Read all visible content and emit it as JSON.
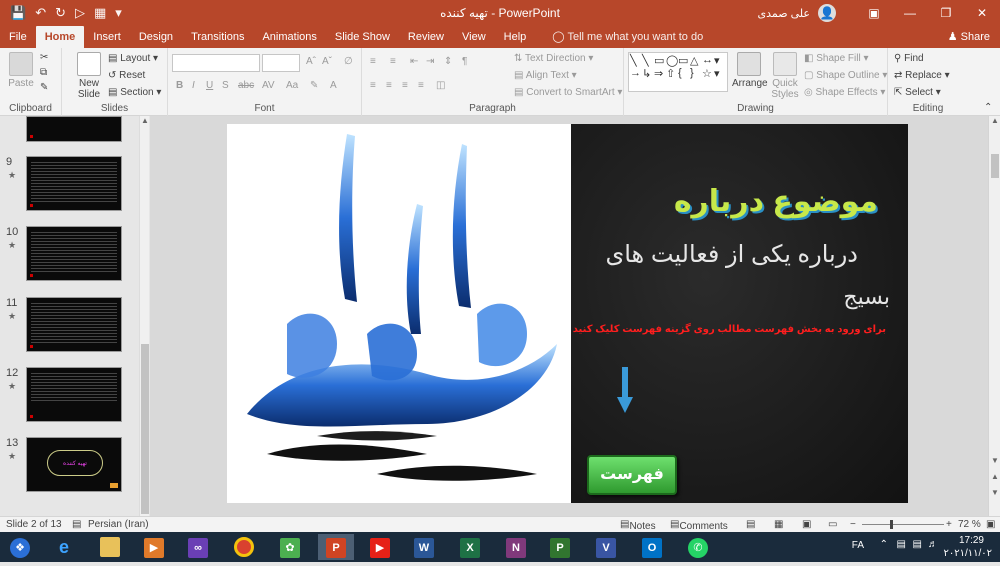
{
  "window": {
    "doc_name": "تهیه کننده",
    "app_name": "PowerPoint",
    "title_separator": " - ",
    "user_name": "علی صمدی",
    "brand_color": "#b7472a"
  },
  "tabs": [
    "File",
    "Home",
    "Insert",
    "Design",
    "Transitions",
    "Animations",
    "Slide Show",
    "Review",
    "View",
    "Help"
  ],
  "tell_me": "Tell me what you want to do",
  "share_label": "Share",
  "ribbon": {
    "clipboard": {
      "label": "Clipboard",
      "paste": "Paste"
    },
    "slides": {
      "label": "Slides",
      "new_slide": "New",
      "new_slide2": "Slide",
      "layout": "Layout",
      "reset": "Reset",
      "section": "Section"
    },
    "font": {
      "label": "Font"
    },
    "paragraph": {
      "label": "Paragraph",
      "text_direction": "Text Direction",
      "align_text": "Align Text",
      "smartart": "Convert to SmartArt"
    },
    "drawing": {
      "label": "Drawing",
      "arrange": "Arrange",
      "quick": "Quick",
      "styles": "Styles",
      "fill": "Shape Fill",
      "outline": "Shape Outline",
      "effects": "Shape Effects"
    },
    "editing": {
      "label": "Editing",
      "find": "Find",
      "replace": "Replace",
      "select": "Select"
    }
  },
  "thumbnails": [
    {
      "num": "9"
    },
    {
      "num": "10"
    },
    {
      "num": "11"
    },
    {
      "num": "12"
    },
    {
      "num": "13"
    }
  ],
  "slide": {
    "title": "موضوع درباره",
    "subtitle_1": "درباره یکی از فعالیت های",
    "subtitle_2": "بسیج",
    "instruction": "برای ورود به بخش فهرست مطالب روی گزینه فهرست کلیک کنید",
    "menu_button": "فهرست",
    "thumb13_text": "تهیه کننده"
  },
  "status": {
    "slide_of": "Slide 2 of 13",
    "language": "Persian (Iran)",
    "notes": "Notes",
    "comments": "Comments",
    "zoom": "72 %"
  },
  "taskbar": {
    "lang": "FA",
    "time": "17:29",
    "date": "۲۰۲۱/۱۱/۰۲"
  }
}
